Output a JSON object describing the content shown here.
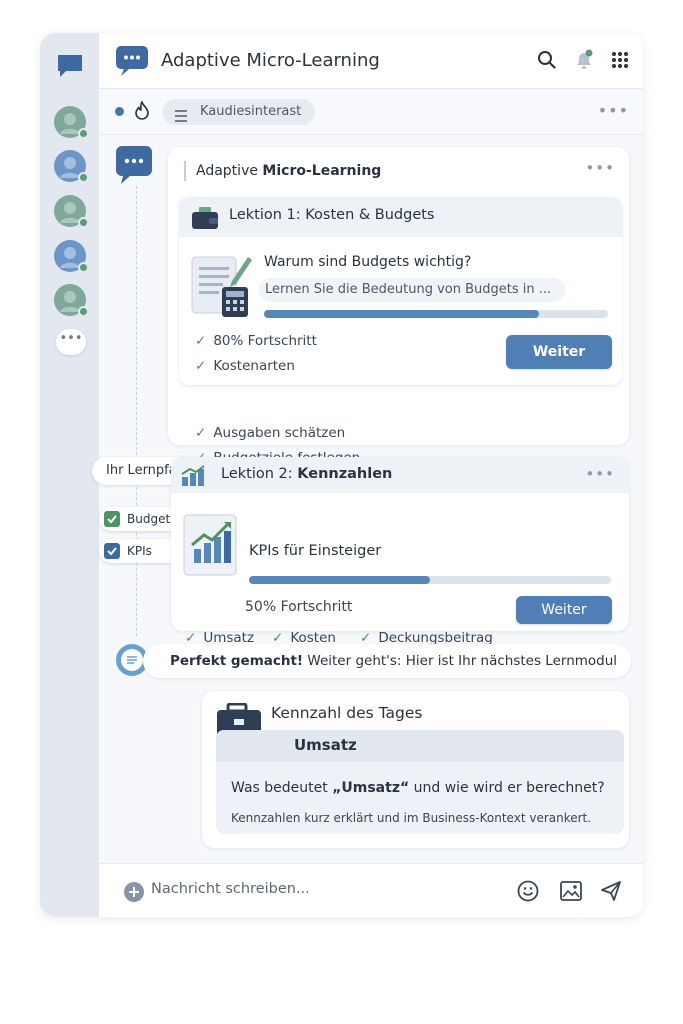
{
  "app": {
    "title": "Adaptive Micro-Learning"
  },
  "subbar": {
    "chip_label": "Kaudiesinterast"
  },
  "card1": {
    "header_regular": "Adaptive ",
    "header_bold": "Micro-Learning",
    "lesson_title": "Lektion 1: Kosten & Budgets",
    "question": "Warum sind Budgets wichtig?",
    "subtitle": "Lernen Sie die Bedeutung von Budgets in ...",
    "progress": 0.8,
    "checks_inner": [
      "80% Fortschritt",
      "Kostenarten"
    ],
    "checks_outer": [
      "Ausgaben schätzen",
      "Budgetziele festlegen"
    ],
    "button": "Weiter"
  },
  "learnpath": {
    "label": "Ihr Lernpfad",
    "items": [
      "Budgets",
      "KPIs"
    ]
  },
  "card2": {
    "title_regular": "Lektion 2: ",
    "title_bold": "Kennzahlen",
    "course": "KPIs für Einsteiger",
    "progress": 0.5,
    "progress_text": "50% Fortschritt",
    "button": "Weiter",
    "checks": [
      "Umsatz",
      "Kosten",
      "Deckungsbeitrag"
    ]
  },
  "message": {
    "bold": "Perfekt gemacht!",
    "text": " Weiter geht's: Hier ist Ihr nächstes Lernmodul"
  },
  "card3": {
    "title": "Kennzahl des Tages",
    "term": "Umsatz",
    "question_pre": "Was bedeutet ",
    "question_bold": "„Umsatz“",
    "question_post": " und wie wird er berechnet?",
    "note": "Kennzahlen kurz erklärt und im Business-Kontext verankert."
  },
  "footer": {
    "placeholder": "Nachricht schreiben..."
  },
  "colors": {
    "accent": "#4f7fb4",
    "check": "#4f9267",
    "online": "#5d9a76"
  }
}
